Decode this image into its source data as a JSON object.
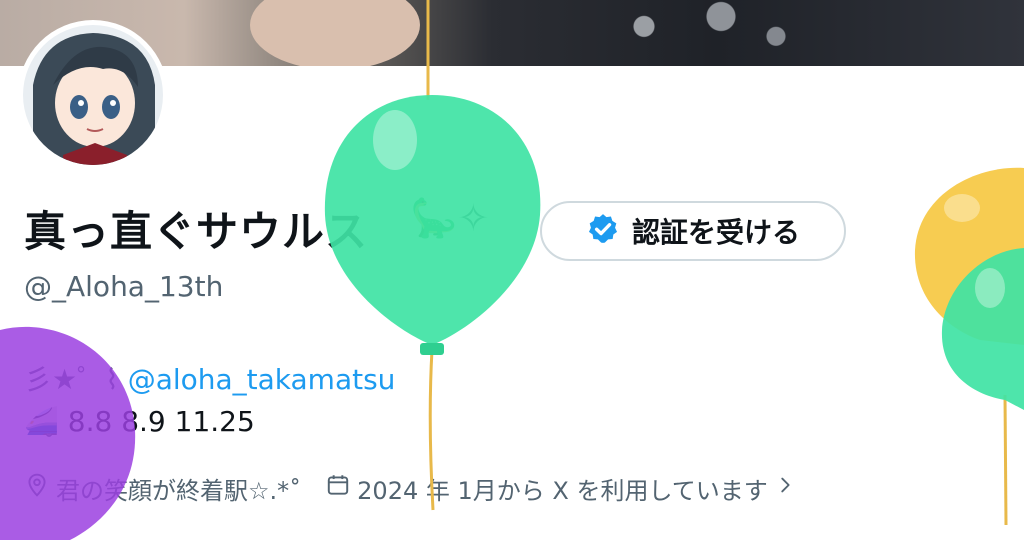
{
  "profile": {
    "display_name": "真っ直ぐサウルス",
    "name_emoji": "🦕✧",
    "handle": "@_Aloha_13th",
    "verify_button_label": "認証を受ける",
    "bio_line1_prefix": "彡★゜⌇",
    "bio_mention": "@aloha_takamatsu",
    "bio_line2_emoji": "🚄",
    "bio_line2_text": "8.8 8.9 11.25",
    "location": "君の笑顔が終着駅☆.*˚",
    "joined": "2024 年 1月から X を利用しています"
  },
  "icons": {
    "verified": "verified-badge-icon",
    "location": "location-pin-icon",
    "calendar": "calendar-icon",
    "chevron": "chevron-right-icon"
  },
  "colors": {
    "accent": "#1d9bf0",
    "text_primary": "#0f1419",
    "text_secondary": "#536471",
    "balloon_green": "#3fe3a4",
    "balloon_purple": "#9b3fe0",
    "balloon_yellow": "#f7c948"
  }
}
